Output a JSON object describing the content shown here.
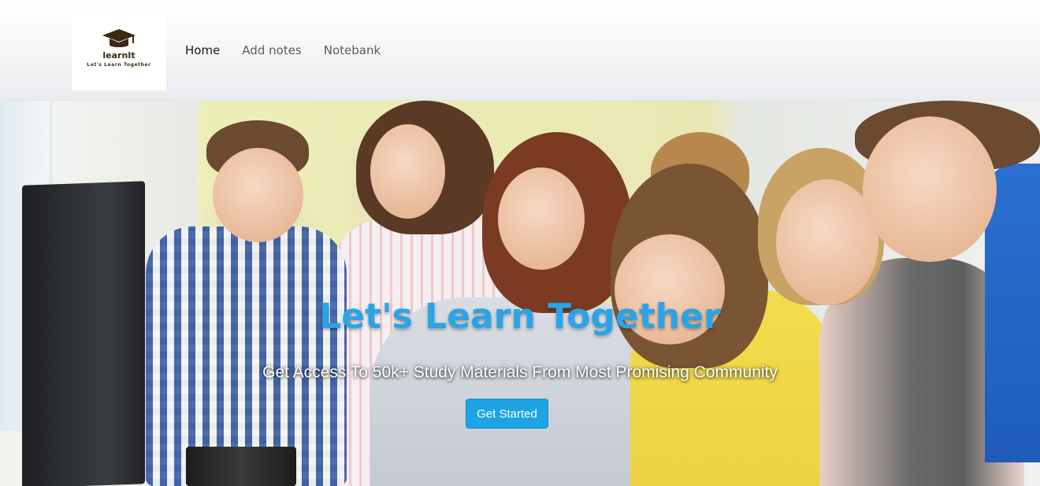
{
  "brand": {
    "name": "learnIt",
    "tagline": "Let's Learn Together",
    "logo_icon": "graduation-cap-icon"
  },
  "nav": {
    "items": [
      {
        "label": "Home",
        "active": true
      },
      {
        "label": "Add notes",
        "active": false
      },
      {
        "label": "Notebank",
        "active": false
      }
    ]
  },
  "hero": {
    "title": "Let's Learn Together",
    "subtitle": "Get Access To 50k+ Study Materials From Most Promising Community",
    "cta_label": "Get Started"
  },
  "colors": {
    "accent": "#1ea4e5",
    "title": "#2aa4e6",
    "brand_dark": "#3a2a14"
  }
}
